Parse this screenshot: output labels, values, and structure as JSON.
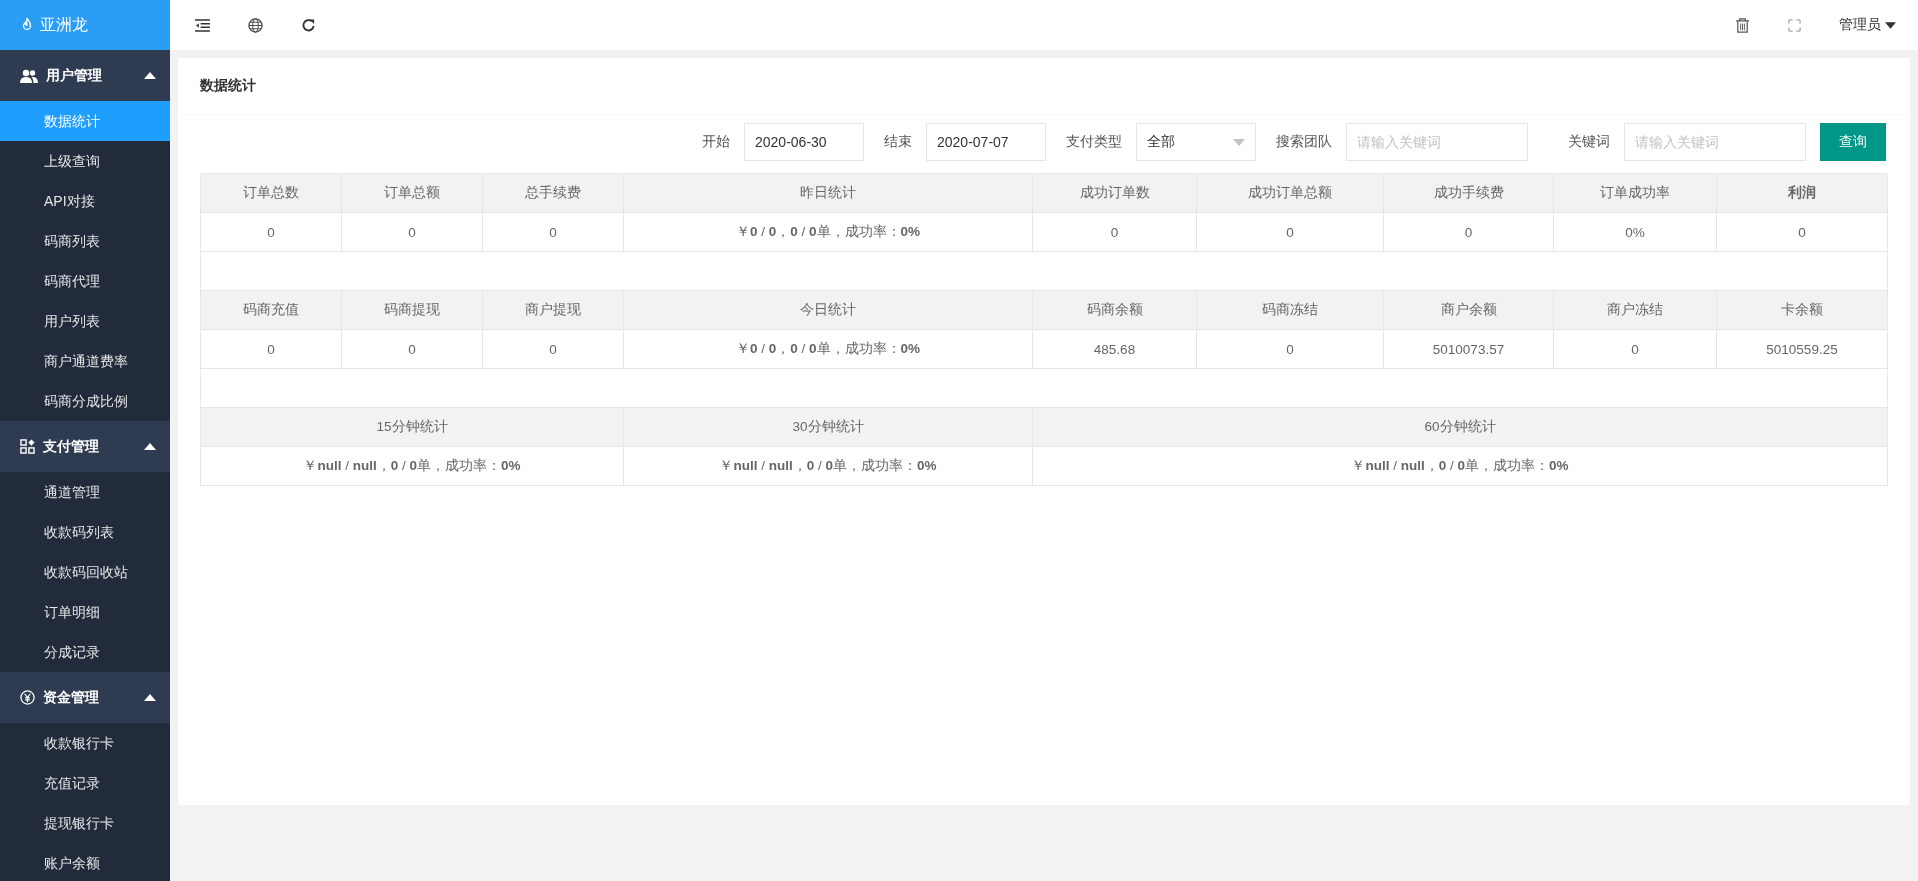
{
  "brand": {
    "name": "亚洲龙"
  },
  "sidebar": {
    "groups": [
      {
        "label": "用户管理",
        "expanded": true,
        "items": [
          {
            "label": "数据统计",
            "selected": true
          },
          {
            "label": "上级查询",
            "selected": false
          },
          {
            "label": "API对接",
            "selected": false
          },
          {
            "label": "码商列表",
            "selected": false
          },
          {
            "label": "码商代理",
            "selected": false
          },
          {
            "label": "用户列表",
            "selected": false
          },
          {
            "label": "商户通道费率",
            "selected": false
          },
          {
            "label": "码商分成比例",
            "selected": false
          }
        ]
      },
      {
        "label": "支付管理",
        "expanded": true,
        "items": [
          {
            "label": "通道管理",
            "selected": false
          },
          {
            "label": "收款码列表",
            "selected": false
          },
          {
            "label": "收款码回收站",
            "selected": false
          },
          {
            "label": "订单明细",
            "selected": false
          },
          {
            "label": "分成记录",
            "selected": false
          }
        ]
      },
      {
        "label": "资金管理",
        "expanded": true,
        "items": [
          {
            "label": "收款银行卡",
            "selected": false
          },
          {
            "label": "充值记录",
            "selected": false
          },
          {
            "label": "提现银行卡",
            "selected": false
          },
          {
            "label": "账户余额",
            "selected": false
          }
        ]
      }
    ]
  },
  "topbar": {
    "user": "管理员"
  },
  "page_title": "数据统计",
  "filters": {
    "start_label": "开始",
    "start_value": "2020-06-30",
    "end_label": "结束",
    "end_value": "2020-07-07",
    "pay_type_label": "支付类型",
    "pay_type_value": "全部",
    "team_label": "搜索团队",
    "team_placeholder": "请输入关键词",
    "keyword_label": "关键词",
    "keyword_placeholder": "请输入关键词",
    "query_button": "查询"
  },
  "sections": [
    {
      "kind": "grid",
      "headers": [
        {
          "label": "订单总数",
          "bold": false
        },
        {
          "label": "订单总额",
          "bold": false
        },
        {
          "label": "总手续费",
          "bold": false
        },
        {
          "label": "昨日统计",
          "bold": false
        },
        {
          "label": "成功订单数",
          "bold": false
        },
        {
          "label": "成功订单总额",
          "bold": false
        },
        {
          "label": "成功手续费",
          "bold": false
        },
        {
          "label": "订单成功率",
          "bold": false
        },
        {
          "label": "利润",
          "bold": true
        }
      ],
      "values": [
        "0",
        "0",
        "0",
        "￥**0** / **0**，**0** / **0**单，成功率：**0%**",
        "0",
        "0",
        "0",
        "0%",
        "0"
      ]
    },
    {
      "kind": "grid",
      "headers": [
        {
          "label": "码商充值",
          "bold": false
        },
        {
          "label": "码商提现",
          "bold": false
        },
        {
          "label": "商户提现",
          "bold": false
        },
        {
          "label": "今日统计",
          "bold": false
        },
        {
          "label": "码商余额",
          "bold": false
        },
        {
          "label": "码商冻结",
          "bold": false
        },
        {
          "label": "商户余额",
          "bold": false
        },
        {
          "label": "商户冻结",
          "bold": false
        },
        {
          "label": "卡余额",
          "bold": false
        }
      ],
      "values": [
        "0",
        "0",
        "0",
        "￥**0** / **0**，**0** / **0**单，成功率：**0%**",
        "485.68",
        "0",
        "5010073.57",
        "0",
        "5010559.25"
      ]
    },
    {
      "kind": "periods",
      "headers": [
        {
          "label": "15分钟统计",
          "bold": false
        },
        {
          "label": "30分钟统计",
          "bold": false
        },
        {
          "label": "60分钟统计",
          "bold": false
        }
      ],
      "values": [
        "￥**null** / **null**，**0** / **0**单，成功率：**0%**",
        "￥**null** / **null**，**0** / **0**单，成功率：**0%**",
        "￥**null** / **null**，**0** / **0**单，成功率：**0%**"
      ]
    }
  ]
}
